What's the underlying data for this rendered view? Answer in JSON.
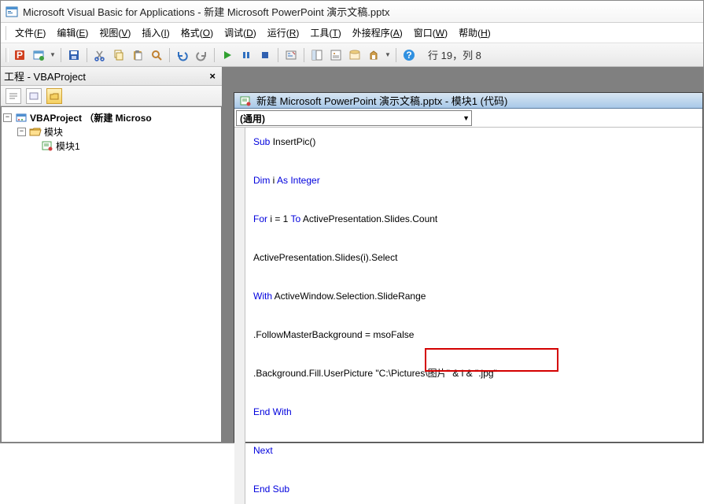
{
  "title": "Microsoft Visual Basic for Applications - 新建 Microsoft PowerPoint 演示文稿.pptx",
  "menus": {
    "file": {
      "pre": "文件(",
      "key": "F",
      "post": ")"
    },
    "edit": {
      "pre": "编辑(",
      "key": "E",
      "post": ")"
    },
    "view": {
      "pre": "视图(",
      "key": "V",
      "post": ")"
    },
    "insert": {
      "pre": "插入(",
      "key": "I",
      "post": ")"
    },
    "format": {
      "pre": "格式(",
      "key": "O",
      "post": ")"
    },
    "debug": {
      "pre": "调试(",
      "key": "D",
      "post": ")"
    },
    "run": {
      "pre": "运行(",
      "key": "R",
      "post": ")"
    },
    "tools": {
      "pre": "工具(",
      "key": "T",
      "post": ")"
    },
    "addins": {
      "pre": "外接程序(",
      "key": "A",
      "post": ")"
    },
    "window": {
      "pre": "窗口(",
      "key": "W",
      "post": ")"
    },
    "help": {
      "pre": "帮助(",
      "key": "H",
      "post": ")"
    }
  },
  "status": "行 19，列 8",
  "project_panel": {
    "title": "工程 - VBAProject",
    "root": "VBAProject （新建 Microso",
    "modules_folder": "模块",
    "module1": "模块1"
  },
  "code_window": {
    "title": "新建 Microsoft PowerPoint 演示文稿.pptx - 模块1 (代码)",
    "dropdown_left": "(通用)"
  },
  "code": {
    "l1a": "Sub",
    "l1b": " InsertPic()",
    "l2a": "Dim",
    "l2b": " i ",
    "l2c": "As Integer",
    "l3a": "For",
    "l3b": " i = 1 ",
    "l3c": "To",
    "l3d": " ActivePresentation.Slides.Count",
    "l4": "ActivePresentation.Slides(i).Select",
    "l5a": "With",
    "l5b": " ActiveWindow.Selection.SlideRange",
    "l6": ".FollowMasterBackground = msoFalse",
    "l7a": ".Background.Fill.UserPicture ",
    "l7b": "\"C:\\Pictures\\图片\"",
    "l7c": " & i & ",
    "l7d": "\".jpg\"",
    "l8": "End With",
    "l9": "Next",
    "l10": "End Sub"
  }
}
